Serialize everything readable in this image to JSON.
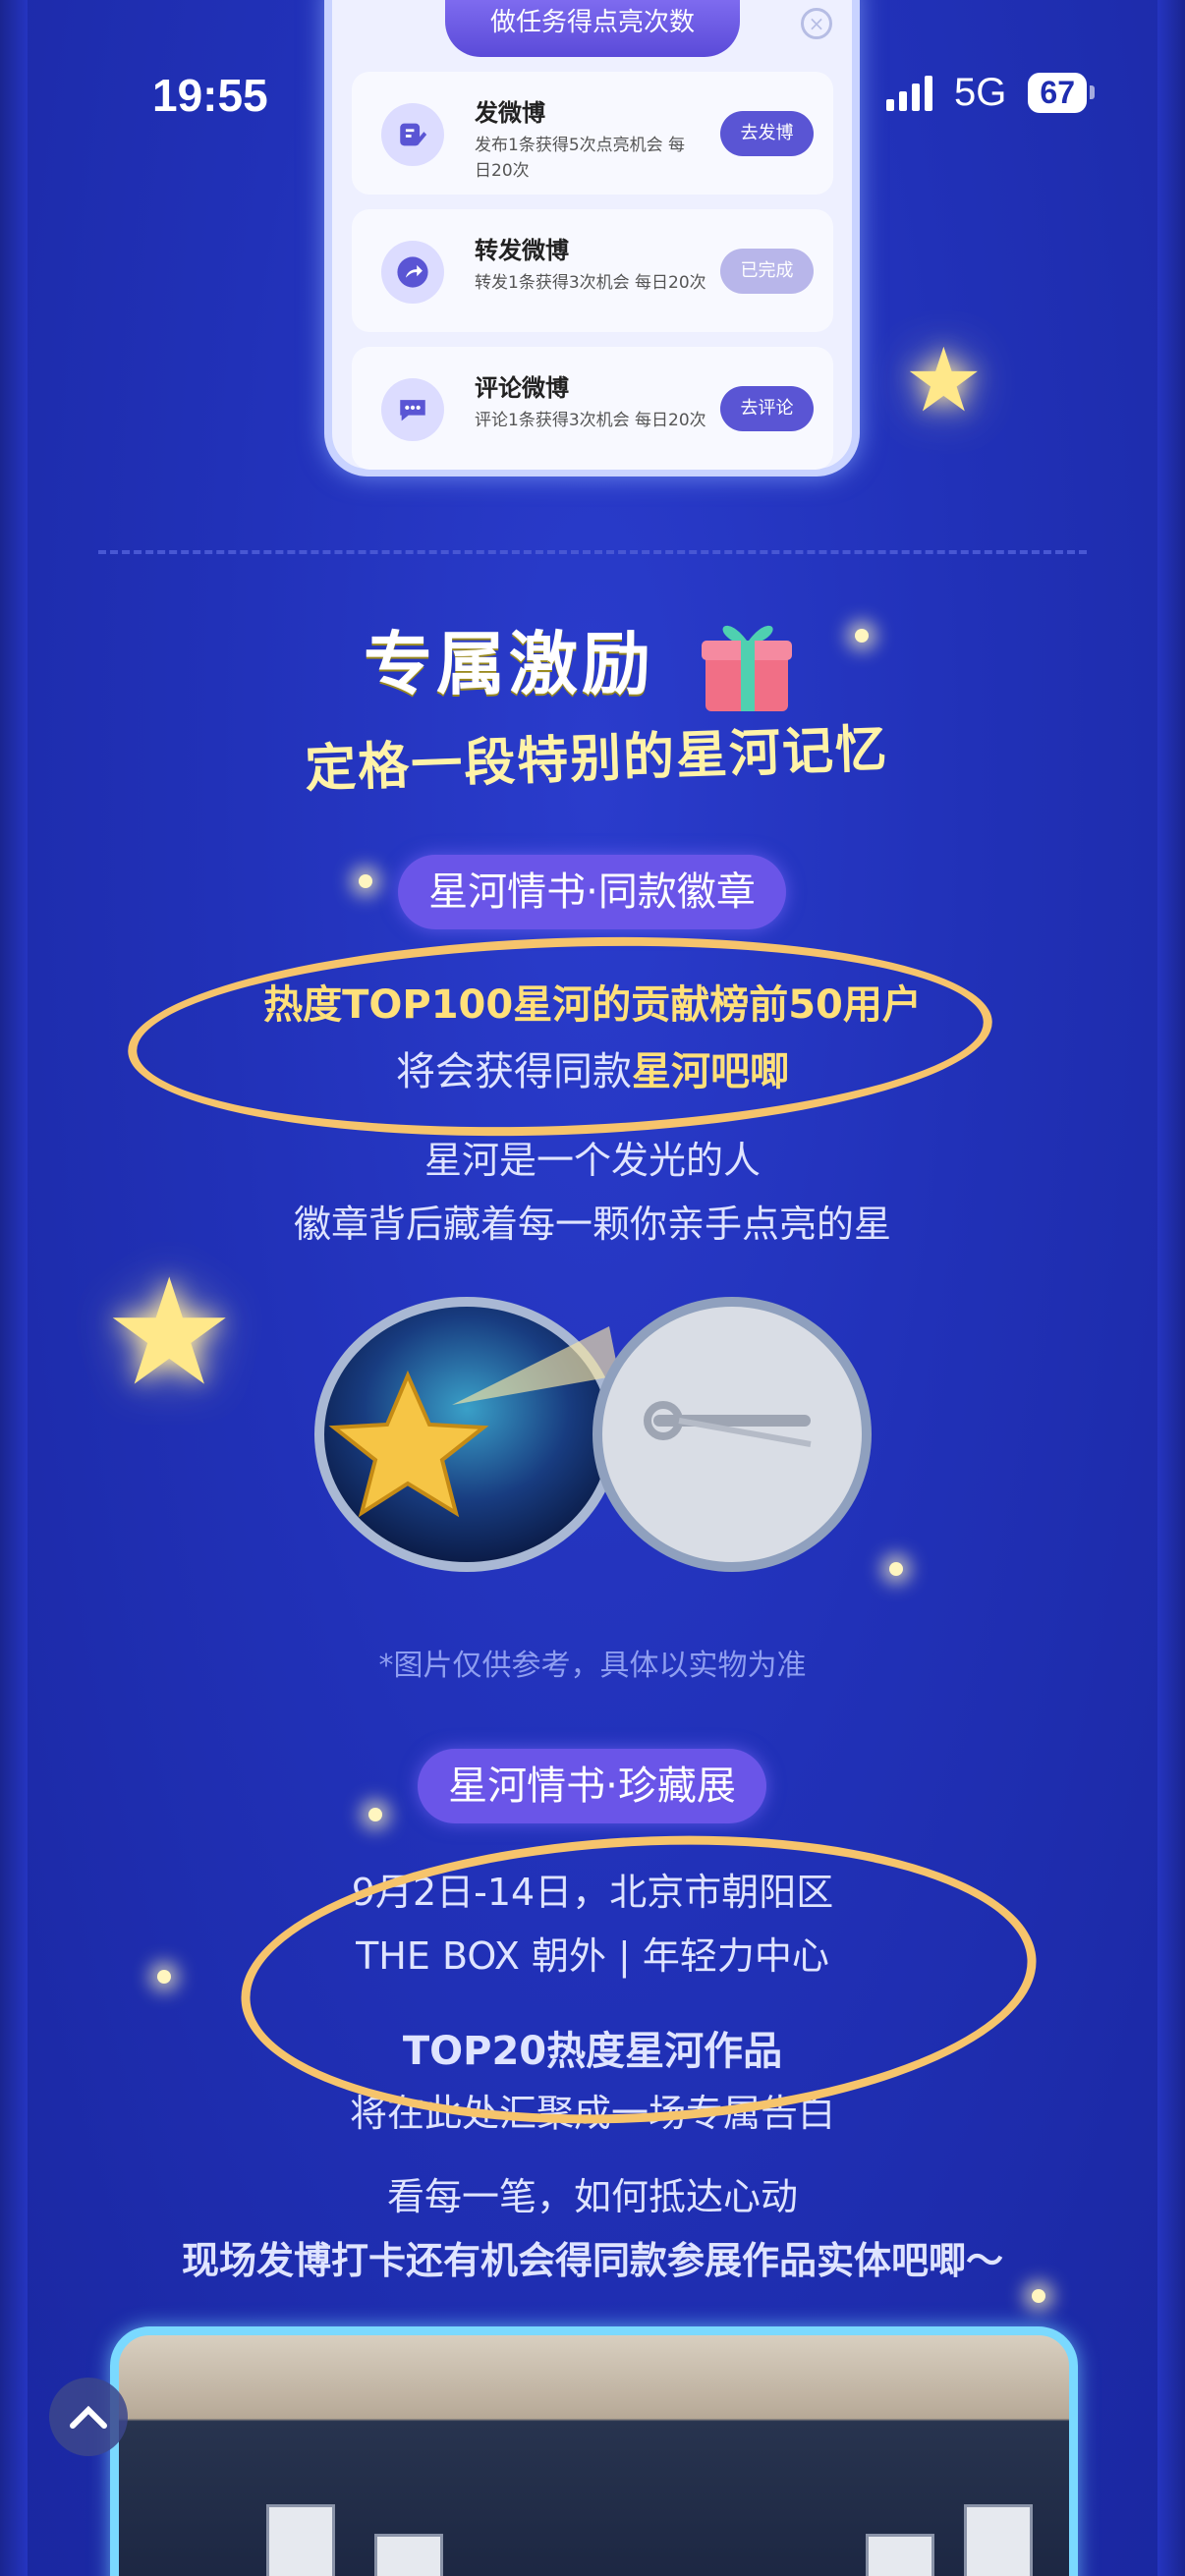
{
  "status_bar": {
    "time": "19:55",
    "network": "5G",
    "battery": "67"
  },
  "task_panel": {
    "title": "做任务得点亮次数",
    "close_icon": "close-icon",
    "tasks": [
      {
        "name": "发微博",
        "desc": "发布1条获得5次点亮机会 每日20次",
        "button": "去发博",
        "done": false,
        "icon": "edit-icon"
      },
      {
        "name": "转发微博",
        "desc": "转发1条获得3次机会 每日20次",
        "button": "已完成",
        "done": true,
        "icon": "share-icon"
      },
      {
        "name": "评论微博",
        "desc": "评论1条获得3次机会 每日20次",
        "button": "去评论",
        "done": false,
        "icon": "comment-icon"
      }
    ]
  },
  "incentive": {
    "title": "专属激励",
    "subtitle": "定格一段特别的星河记忆"
  },
  "badge_section": {
    "pill": "星河情书·同款徽章",
    "line1_pre": "热度TOP100星河的贡献榜",
    "line1_bold": "前50用户",
    "line2_pre": "将会获得同款",
    "line2_bold": "星河吧唧",
    "line3": "星河是一个发光的人",
    "line4": "徽章背后藏着每一颗你亲手点亮的星",
    "note": "*图片仅供参考，具体以实物为准"
  },
  "expo_section": {
    "pill": "星河情书·珍藏展",
    "line1": "9月2日-14日，北京市朝阳区",
    "line2": "THE BOX 朝外 | 年轻力中心",
    "line3": "TOP20热度星河作品",
    "line4": "将在此处汇聚成一场专属告白",
    "line5": "看每一笔，如何抵达心动",
    "line6": "现场发博打卡还有机会得同款参展作品实体吧唧～"
  },
  "colors": {
    "background": "#2131b8",
    "highlight": "#ffe07a",
    "pill": "#6a55e8",
    "ellipse": "#f6c46c"
  }
}
